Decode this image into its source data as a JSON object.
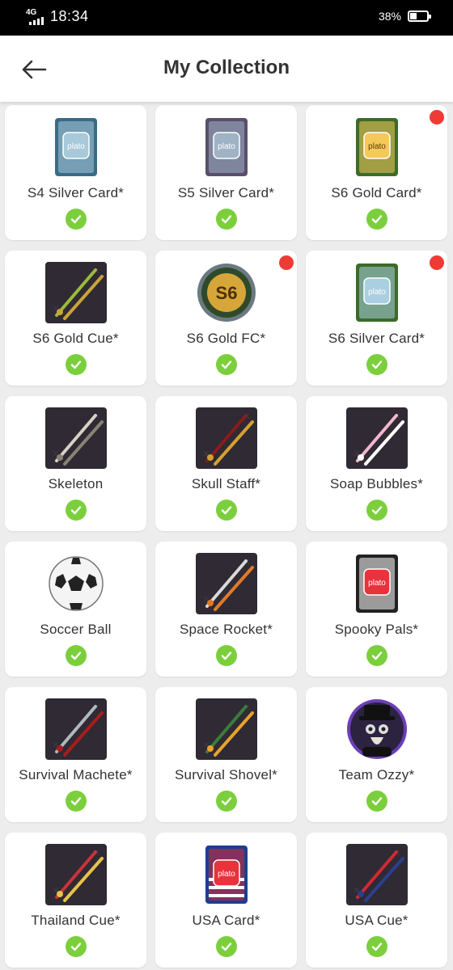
{
  "status": {
    "network": "4G",
    "time": "18:34",
    "battery_text": "38%",
    "battery_level": 0.38
  },
  "header": {
    "title": "My Collection",
    "back_icon": "arrow-left-icon"
  },
  "colors": {
    "check": "#7ccf3c",
    "new_dot": "#ee3b36",
    "header_bg": "#ffffff",
    "page_bg": "#ededed"
  },
  "items": [
    {
      "name": "S4 Silver Card*",
      "icon": "card-icon",
      "collected": true,
      "is_new": false
    },
    {
      "name": "S5 Silver Card*",
      "icon": "card-icon",
      "collected": true,
      "is_new": false
    },
    {
      "name": "S6 Gold Card*",
      "icon": "card-icon",
      "collected": true,
      "is_new": true
    },
    {
      "name": "S6 Gold Cue*",
      "icon": "cue-icon",
      "collected": true,
      "is_new": false
    },
    {
      "name": "S6 Gold FC*",
      "icon": "badge-icon",
      "collected": true,
      "is_new": true
    },
    {
      "name": "S6 Silver Card*",
      "icon": "card-icon",
      "collected": true,
      "is_new": true
    },
    {
      "name": "Skeleton",
      "icon": "cue-icon",
      "collected": true,
      "is_new": false
    },
    {
      "name": "Skull Staff*",
      "icon": "cue-icon",
      "collected": true,
      "is_new": false
    },
    {
      "name": "Soap Bubbles*",
      "icon": "cue-icon",
      "collected": true,
      "is_new": false
    },
    {
      "name": "Soccer Ball",
      "icon": "soccer-ball-icon",
      "collected": true,
      "is_new": false
    },
    {
      "name": "Space Rocket*",
      "icon": "cue-icon",
      "collected": true,
      "is_new": false
    },
    {
      "name": "Spooky Pals*",
      "icon": "card-icon",
      "collected": true,
      "is_new": false
    },
    {
      "name": "Survival Machete*",
      "icon": "cue-icon",
      "collected": true,
      "is_new": false
    },
    {
      "name": "Survival Shovel*",
      "icon": "cue-icon",
      "collected": true,
      "is_new": false
    },
    {
      "name": "Team Ozzy*",
      "icon": "avatar-icon",
      "collected": true,
      "is_new": false
    },
    {
      "name": "Thailand Cue*",
      "icon": "cue-icon",
      "collected": true,
      "is_new": false
    },
    {
      "name": "USA Card*",
      "icon": "card-icon",
      "collected": true,
      "is_new": false
    },
    {
      "name": "USA Cue*",
      "icon": "cue-icon",
      "collected": true,
      "is_new": false
    }
  ],
  "card_brand": "plato",
  "badge_text": "S6"
}
